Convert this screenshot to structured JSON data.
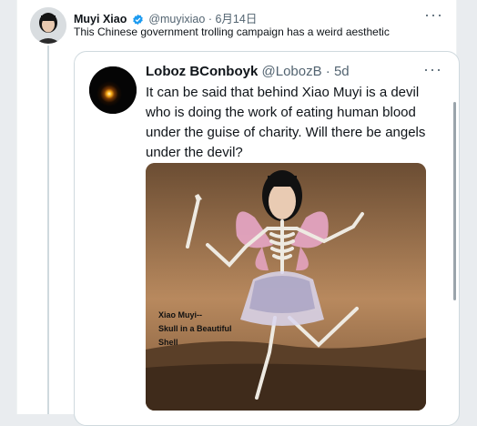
{
  "tweet": {
    "author_name": "Muyi Xiao",
    "author_handle": "@muyixiao",
    "separator": "·",
    "date": "6月14日",
    "more": "···",
    "text": "This Chinese government trolling campaign has a weird aesthetic",
    "verified_icon": "verified-badge-icon",
    "colors": {
      "verified": "#1d9bf0",
      "secondary_text": "#536471",
      "border": "#cfd9de"
    }
  },
  "quoted": {
    "author_name": "Loboz BConboyk",
    "author_handle": "@LobozB",
    "separator": "·",
    "age": "5d",
    "more": "···",
    "text": "It can be said that behind Xiao Muyi is a devil who is doing the work of eating human blood under the guise of charity. Will there be angels under the devil?",
    "media": {
      "caption_lines": [
        "Xiao Muyi--",
        "Skull in a Beautiful",
        "Shell"
      ]
    }
  }
}
